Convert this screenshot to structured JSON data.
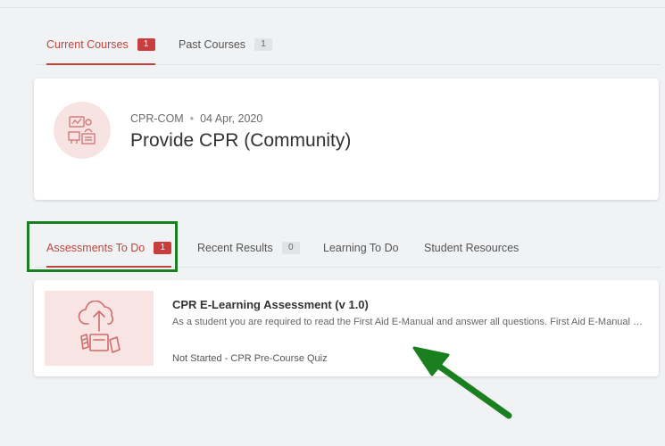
{
  "course_tabs": [
    {
      "label": "Current Courses",
      "count": "1",
      "active": true
    },
    {
      "label": "Past Courses",
      "count": "1",
      "active": false
    }
  ],
  "course": {
    "code": "CPR-COM",
    "separator": "•",
    "date": "04 Apr, 2020",
    "title": "Provide CPR (Community)",
    "icon": "classroom-icon"
  },
  "assessment_tabs": [
    {
      "label": "Assessments To Do",
      "count": "1",
      "active": true
    },
    {
      "label": "Recent Results",
      "count": "0",
      "active": false
    },
    {
      "label": "Learning To Do",
      "active": false
    },
    {
      "label": "Student Resources",
      "active": false
    }
  ],
  "assessment": {
    "title": "CPR E-Learning Assessment (v 1.0)",
    "description": "As a student you are required to read the First Aid E-Manual and answer all questions.   First Aid E-Manual requirements apply before attempting the assessment.",
    "status": "Not Started - CPR Pre-Course Quiz",
    "icon": "cloud-upload-icon"
  },
  "colors": {
    "accent": "#c0443e",
    "badge_red": "#c93d3d",
    "annotation_green": "#1a7f1e",
    "thumb_bg": "#f9e4e4"
  }
}
